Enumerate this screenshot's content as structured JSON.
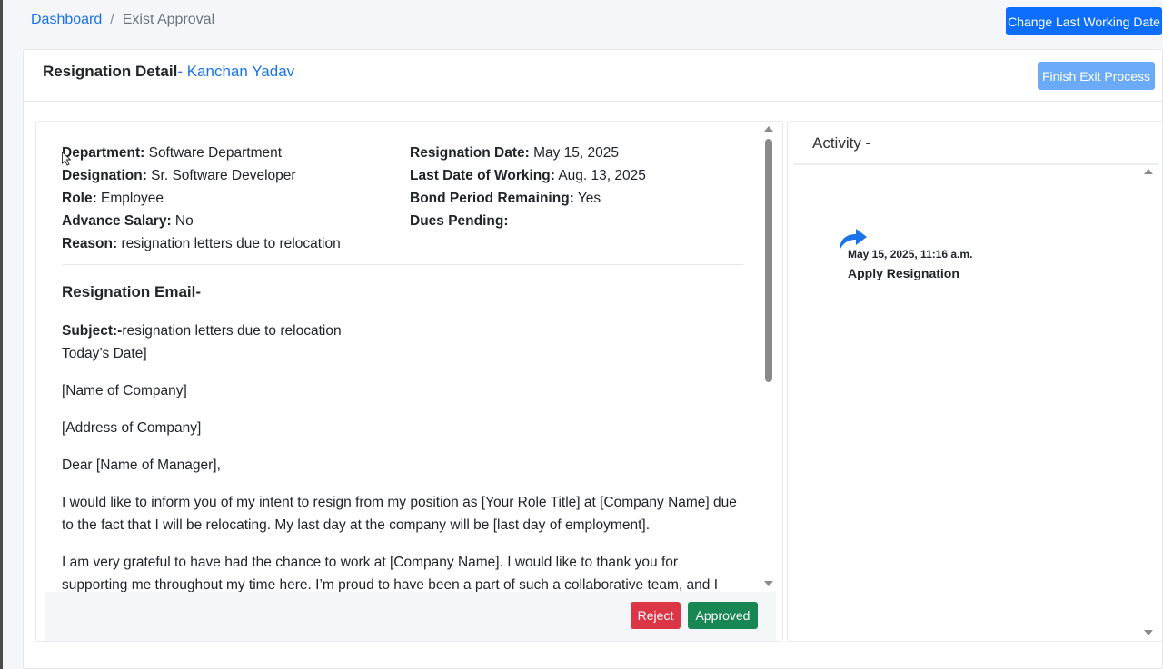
{
  "breadcrumb": {
    "home": "Dashboard",
    "separator": "/",
    "current": "Exist Approval"
  },
  "toolbar": {
    "change_last_working_date": "Change Last Working Date"
  },
  "detail": {
    "title": "Resignation Detail",
    "name": "- Kanchan Yadav",
    "finish_button": "Finish Exit Process",
    "left_fields": [
      {
        "label": "Department:",
        "value": " Software Department"
      },
      {
        "label": "Designation:",
        "value": " Sr. Software Developer"
      },
      {
        "label": "Role:",
        "value": " Employee"
      },
      {
        "label": "Advance Salary:",
        "value": " No"
      },
      {
        "label": "Reason:",
        "value": " resignation letters due to relocation"
      }
    ],
    "right_fields": [
      {
        "label": "Resignation Date:",
        "value": " May 15, 2025"
      },
      {
        "label": "Last Date of Working:",
        "value": " Aug. 13, 2025"
      },
      {
        "label": "Bond Period Remaining:",
        "value": " Yes"
      },
      {
        "label": "Dues Pending:",
        "value": ""
      }
    ]
  },
  "email": {
    "heading": "Resignation Email-",
    "subject_label": "Subject:-",
    "subject_value": "resignation letters due to relocation",
    "date_line": "Today’s Date]",
    "company_name": "[Name of Company]",
    "company_address": "[Address of Company]",
    "salutation": "Dear [Name of Manager],",
    "para1": "I would like to inform you of my intent to resign from my position as [Your Role Title] at [Company Name] due to the fact that I will be relocating. My last day at the company will be [last day of employment].",
    "para2": "I am very grateful to have had the chance to work at [Company Name]. I would like to thank you for supporting me throughout my time here. I’m proud to have been a part of such a collaborative team, and I"
  },
  "actions": {
    "reject": "Reject",
    "approve": "Approved"
  },
  "activity": {
    "title": "Activity -",
    "items": [
      {
        "date": "May 15, 2025, 11:16 a.m.",
        "label": "Apply Resignation",
        "icon": "share-arrow-icon"
      }
    ]
  },
  "colors": {
    "primary": "#0d6efd",
    "primary_light": "#6aaaf7",
    "link": "#1a73e8",
    "danger": "#dc3545",
    "success": "#198754"
  }
}
